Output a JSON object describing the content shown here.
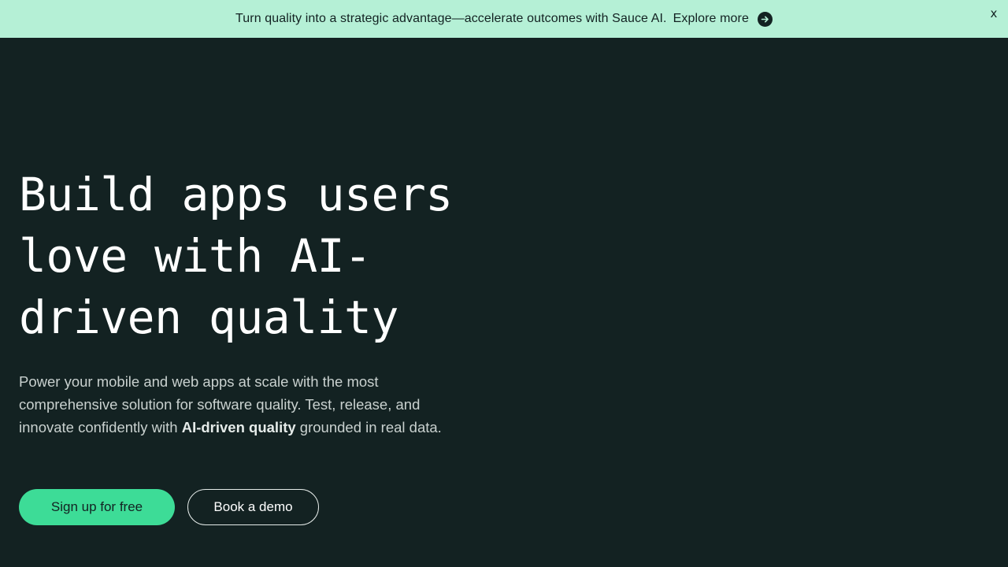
{
  "banner": {
    "text": "Turn quality into a strategic advantage—accelerate outcomes with Sauce AI.",
    "link_label": "Explore more",
    "link_icon": "arrow-right-circle-icon",
    "close_label": "x",
    "background": "#b5f0d6"
  },
  "hero": {
    "title": "Build apps users love with AI-driven quality",
    "description_before": "Power your mobile and web apps at scale with the most comprehensive solution for software quality. Test, release, and innovate confidently with ",
    "description_bold": "AI-driven quality",
    "description_after": " grounded in real data.",
    "background": "#132222"
  },
  "cta": {
    "primary_label": "Sign up for free",
    "secondary_label": "Book a demo",
    "accent": "#3ddc97"
  }
}
